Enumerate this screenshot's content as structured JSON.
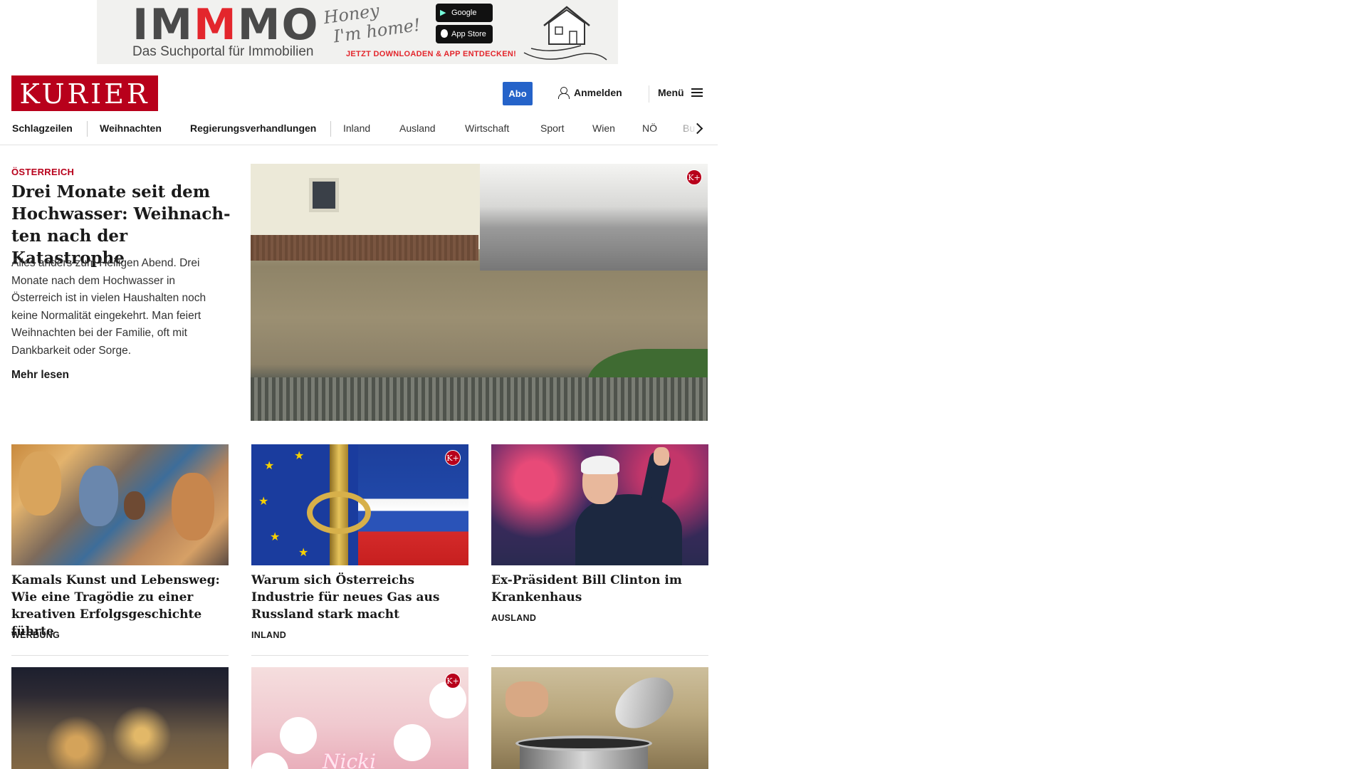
{
  "ad": {
    "brand_prefix": "IM",
    "brand_highlight": "M",
    "brand_suffix": "MO",
    "tagline": "Das Suchportal für Immobilien",
    "slogan_line1": "Honey",
    "slogan_line2": "I'm home!",
    "google_play": "Google Play",
    "app_store": "App Store",
    "cta": "JETZT DOWNLOADEN & APP ENTDECKEN!"
  },
  "header": {
    "logo": "KURIER",
    "abo": "Abo",
    "login": "Anmelden",
    "menu": "Menü"
  },
  "nav": {
    "items": [
      "Schlagzeilen",
      "Weihnachten",
      "Regierungsverhandlungen",
      "Inland",
      "Ausland",
      "Wirtschaft",
      "Sport",
      "Wien",
      "NÖ",
      "Bu"
    ]
  },
  "lead": {
    "kicker": "ÖSTERREICH",
    "title": "Drei Monate seit dem Hochwasser: Weihnach-ten nach der Katastrophe",
    "text": "Alles anders zum Heiligen Abend. Drei Monate nach dem Hochwasser in Österreich ist in vielen Haushalten noch keine Normalität eingekehrt. Man feiert Weihnachten bei der Familie, oft mit Dankbarkeit oder Sorge.",
    "more": "Mehr lesen",
    "badge": "K+"
  },
  "cards": [
    {
      "title": "Kamals Kunst und Lebensweg: Wie eine Tragödie zu einer kreativen Erfolgsgeschichte führte",
      "category": "WERBUNG"
    },
    {
      "title": "Warum sich Österreichs Industrie für neues Gas aus Russland stark macht",
      "category": "INLAND",
      "badge": "K+"
    },
    {
      "title": "Ex-Präsident Bill Clinton im Krankenhaus",
      "category": "AUSLAND"
    },
    {
      "title": "",
      "category": ""
    },
    {
      "title": "",
      "category": "",
      "badge": "K+",
      "neon": "Nicki"
    },
    {
      "title": "",
      "category": ""
    }
  ],
  "colors": {
    "brand_red": "#b8001b",
    "abo_blue": "#2563c9",
    "ad_red": "#e3262c"
  }
}
